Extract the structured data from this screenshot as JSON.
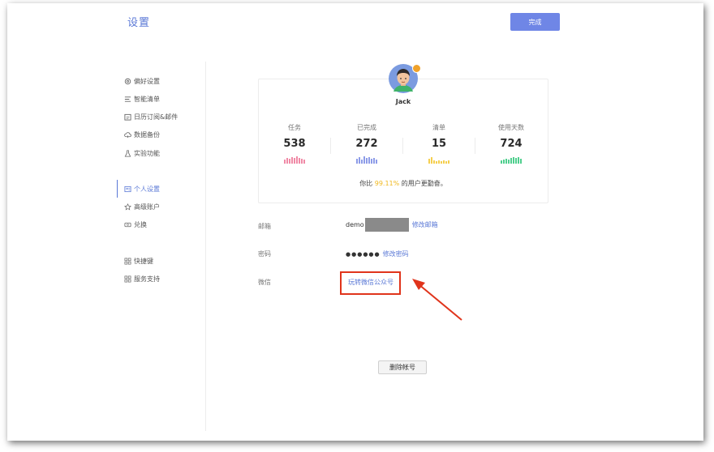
{
  "header": {
    "title": "设置",
    "done_label": "完成"
  },
  "sidebar": {
    "groups": [
      [
        {
          "label": "偏好设置",
          "icon": "gear-icon"
        },
        {
          "label": "智能清单",
          "icon": "smart-list-icon"
        },
        {
          "label": "日历订阅&邮件",
          "icon": "calendar-icon"
        },
        {
          "label": "数据备份",
          "icon": "cloud-icon"
        },
        {
          "label": "实验功能",
          "icon": "flask-icon"
        }
      ],
      [
        {
          "label": "个人设置",
          "icon": "profile-icon",
          "active": true
        },
        {
          "label": "高级账户",
          "icon": "crown-icon"
        },
        {
          "label": "兑换",
          "icon": "ticket-icon"
        }
      ],
      [
        {
          "label": "快捷键",
          "icon": "grid-icon"
        },
        {
          "label": "服务支持",
          "icon": "grid-icon"
        }
      ]
    ]
  },
  "profile": {
    "username": "Jack",
    "stats": [
      {
        "label": "任务",
        "value": "538",
        "color": "#f08aa6"
      },
      {
        "label": "已完成",
        "value": "272",
        "color": "#8d9ce8"
      },
      {
        "label": "清单",
        "value": "15",
        "color": "#f5cf4f"
      },
      {
        "label": "使用天数",
        "value": "724",
        "color": "#4fcf8e"
      }
    ],
    "compare_prefix": "你比 ",
    "compare_pct": "99.11%",
    "compare_suffix": " 的用户更勤奋。"
  },
  "account": {
    "email_label": "邮箱",
    "email_value": "demo",
    "email_action": "修改邮箱",
    "password_label": "密码",
    "password_value": "●●●●●●",
    "password_action": "修改密码",
    "wechat_label": "微信",
    "wechat_action": "玩转微信公众号"
  },
  "delete_label": "删除帐号",
  "annotation_color": "#e0341b",
  "accent_color": "#5a78d6"
}
